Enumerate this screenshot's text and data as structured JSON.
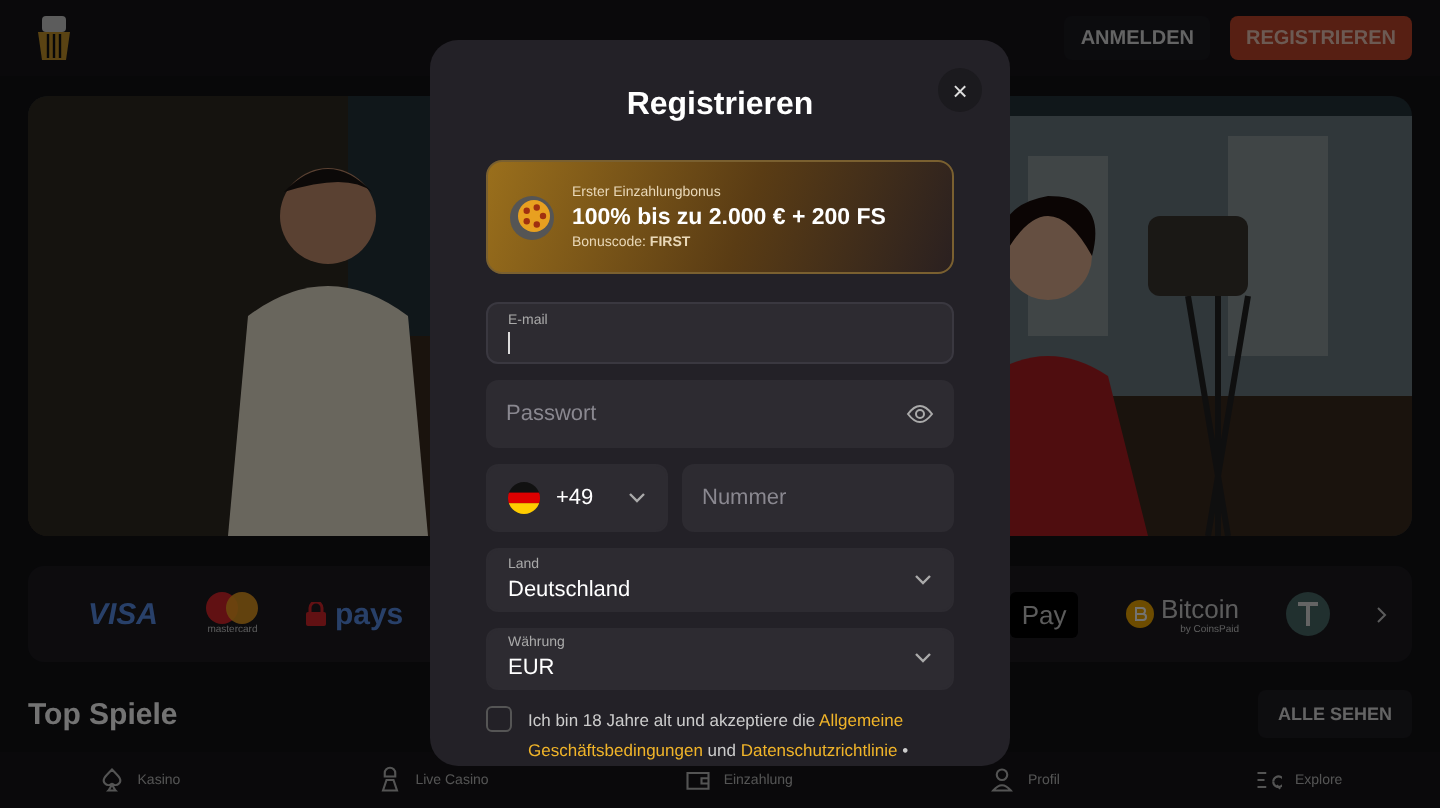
{
  "header": {
    "buttons": [
      {
        "label": "ANMELDEN",
        "kind": "ghost"
      },
      {
        "label": "REGISTRIEREN",
        "kind": "primary"
      }
    ]
  },
  "payments": {
    "items": [
      {
        "label": "VISA",
        "kind": "visa"
      },
      {
        "label": "mastercard",
        "kind": "mastercard"
      },
      {
        "label": "pays",
        "kind": "paysafe"
      },
      {
        "label": "Pay",
        "kind": "applepay"
      },
      {
        "label": "Bitcoin",
        "sub": "by CoinsPaid",
        "kind": "bitcoin"
      },
      {
        "kind": "tether"
      }
    ]
  },
  "section": {
    "title": "Top Spiele",
    "action": "ALLE SEHEN"
  },
  "bottom_nav": [
    {
      "label": "Kasino",
      "kind": "spade"
    },
    {
      "label": "Live Casino",
      "kind": "dealer"
    },
    {
      "label": "Einzahlung",
      "kind": "wallet"
    },
    {
      "label": "Profil",
      "kind": "user"
    },
    {
      "label": "Explore",
      "kind": "explore"
    }
  ],
  "modal": {
    "title": "Registrieren",
    "close": "×",
    "bonus": {
      "eyebrow": "Erster Einzahlungbonus",
      "headline": "100% bis zu 2.000 € + 200 FS",
      "code": "Bonuscode: **FIRST**"
    },
    "email": {
      "label": "E-mail",
      "focused": true
    },
    "password": {
      "placeholder": "Passwort"
    },
    "phone": {
      "code": "+49",
      "placeholder": "Nummer"
    },
    "country": {
      "label": "Land",
      "value": "Deutschland"
    },
    "currency": {
      "label": "Währung",
      "value": "EUR"
    },
    "consent": {
      "checked": false,
      "parts": [
        {
          "kind": "text",
          "text": "Ich bin 18 Jahre alt und akzeptiere die "
        },
        {
          "kind": "link",
          "text": "Allgemeine"
        },
        {
          "kind": "link",
          "text": "Geschäftsbedingungen"
        },
        {
          "kind": "text",
          "text": " und "
        },
        {
          "kind": "link",
          "text": "Datenschutzrichtlinie"
        },
        {
          "kind": "text",
          "text": " •"
        }
      ]
    }
  }
}
